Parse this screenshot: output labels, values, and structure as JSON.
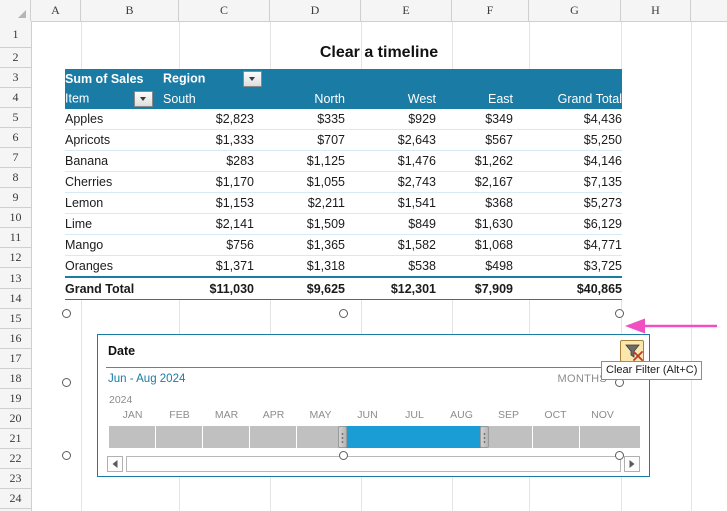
{
  "spreadsheet": {
    "title": "Clear a timeline",
    "columns": [
      "A",
      "B",
      "C",
      "D",
      "E",
      "F",
      "G",
      "H"
    ],
    "rows": [
      "1",
      "2",
      "3",
      "4",
      "5",
      "6",
      "7",
      "8",
      "9",
      "10",
      "11",
      "12",
      "13",
      "14",
      "15",
      "16",
      "17",
      "18",
      "19",
      "20",
      "21",
      "22",
      "23",
      "24"
    ]
  },
  "pivot": {
    "value_field_label": "Sum of Sales",
    "column_field_label": "Region",
    "row_field_label": "Item",
    "column_headers": [
      "South",
      "North",
      "West",
      "East",
      "Grand Total"
    ],
    "rows": [
      {
        "item": "Apples",
        "south": "$2,823",
        "north": "$335",
        "west": "$929",
        "east": "$349",
        "total": "$4,436"
      },
      {
        "item": "Apricots",
        "south": "$1,333",
        "north": "$707",
        "west": "$2,643",
        "east": "$567",
        "total": "$5,250"
      },
      {
        "item": "Banana",
        "south": "$283",
        "north": "$1,125",
        "west": "$1,476",
        "east": "$1,262",
        "total": "$4,146"
      },
      {
        "item": "Cherries",
        "south": "$1,170",
        "north": "$1,055",
        "west": "$2,743",
        "east": "$2,167",
        "total": "$7,135"
      },
      {
        "item": "Lemon",
        "south": "$1,153",
        "north": "$2,211",
        "west": "$1,541",
        "east": "$368",
        "total": "$5,273"
      },
      {
        "item": "Lime",
        "south": "$2,141",
        "north": "$1,509",
        "west": "$849",
        "east": "$1,630",
        "total": "$6,129"
      },
      {
        "item": "Mango",
        "south": "$756",
        "north": "$1,365",
        "west": "$1,582",
        "east": "$1,068",
        "total": "$4,771"
      },
      {
        "item": "Oranges",
        "south": "$1,371",
        "north": "$1,318",
        "west": "$538",
        "east": "$498",
        "total": "$3,725"
      }
    ],
    "grand_total": {
      "item": "Grand Total",
      "south": "$11,030",
      "north": "$9,625",
      "west": "$12,301",
      "east": "$7,909",
      "total": "$40,865"
    },
    "header_color": "#1a7ba5"
  },
  "timeline": {
    "title": "Date",
    "selected_range": "Jun - Aug 2024",
    "level": "MONTHS",
    "year": "2024",
    "months": [
      "JAN",
      "FEB",
      "MAR",
      "APR",
      "MAY",
      "JUN",
      "JUL",
      "AUG",
      "SEP",
      "OCT",
      "NOV"
    ],
    "selected_months": [
      "JUN",
      "JUL",
      "AUG"
    ],
    "clear_filter_tooltip": "Clear Filter (Alt+C)",
    "accent_color": "#1a9cd4",
    "track_color": "#c0c0c0"
  },
  "annotation": {
    "arrow_color": "#ef4fc0"
  }
}
